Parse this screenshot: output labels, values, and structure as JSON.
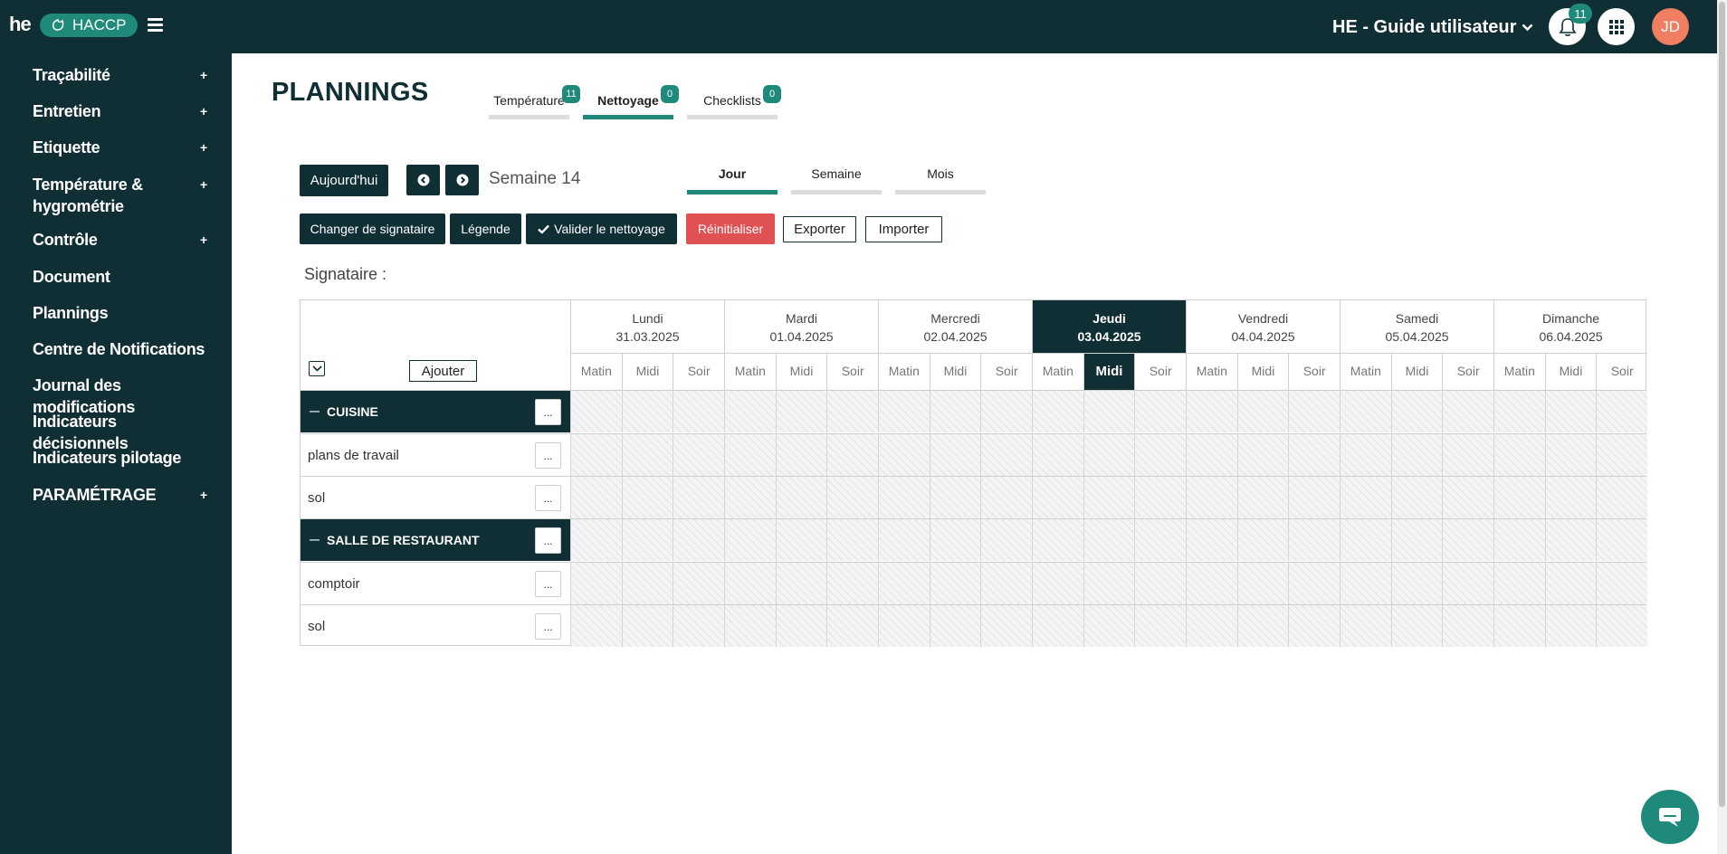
{
  "header": {
    "logo_text": "he",
    "app_name": "HACCP",
    "account_name": "HE - Guide utilisateur",
    "notification_count": "11",
    "avatar_initials": "JD"
  },
  "sidebar": {
    "items": [
      {
        "label": "Traçabilité",
        "expandable": true
      },
      {
        "label": "Entretien",
        "expandable": true
      },
      {
        "label": "Etiquette",
        "expandable": true
      },
      {
        "label": "Température & hygrométrie",
        "expandable": true
      },
      {
        "label": "Contrôle",
        "expandable": true
      },
      {
        "label": "Document",
        "expandable": false
      },
      {
        "label": "Plannings",
        "expandable": false
      },
      {
        "label": "Centre de Notifications",
        "expandable": false
      },
      {
        "label": "Journal des modifications",
        "expandable": false
      },
      {
        "label": "Indicateurs décisionnels",
        "expandable": false
      },
      {
        "label": "Indicateurs pilotage",
        "expandable": false
      },
      {
        "label": "PARAMÉTRAGE",
        "expandable": true
      }
    ],
    "plus_symbol": "+"
  },
  "main": {
    "title": "PLANNINGS",
    "tabs": [
      {
        "label": "Température",
        "badge": "11",
        "active": false
      },
      {
        "label": "Nettoyage",
        "badge": "0",
        "active": true
      },
      {
        "label": "Checklists",
        "badge": "0",
        "active": false
      }
    ],
    "toolbar": {
      "today_label": "Aujourd'hui",
      "week_label": "Semaine 14",
      "change_signer_label": "Changer de signataire",
      "legend_label": "Légende",
      "validate_label": "Valider le nettoyage",
      "reset_label": "Réinitialiser",
      "export_label": "Exporter",
      "import_label": "Importer"
    },
    "view_tabs": [
      {
        "label": "Jour",
        "active": true
      },
      {
        "label": "Semaine",
        "active": false
      },
      {
        "label": "Mois",
        "active": false
      }
    ],
    "signataire_label": "Signataire :"
  },
  "planning": {
    "add_label": "Ajouter",
    "slots": [
      "Matin",
      "Midi",
      "Soir"
    ],
    "days": [
      {
        "name": "Lundi",
        "date": "31.03.2025"
      },
      {
        "name": "Mardi",
        "date": "01.04.2025"
      },
      {
        "name": "Mercredi",
        "date": "02.04.2025"
      },
      {
        "name": "Jeudi",
        "date": "03.04.2025"
      },
      {
        "name": "Vendredi",
        "date": "04.04.2025"
      },
      {
        "name": "Samedi",
        "date": "05.04.2025"
      },
      {
        "name": "Dimanche",
        "date": "06.04.2025"
      }
    ],
    "active_day": 3,
    "active_slot": "Midi",
    "rows": [
      {
        "type": "group",
        "label": "CUISINE"
      },
      {
        "type": "task",
        "label": "plans de travail"
      },
      {
        "type": "task",
        "label": "sol"
      },
      {
        "type": "group",
        "label": "SALLE DE RESTAURANT"
      },
      {
        "type": "task",
        "label": "comptoir"
      },
      {
        "type": "task",
        "label": "sol"
      }
    ],
    "menu_dots": "..."
  },
  "colors": {
    "primary_dark": "#0f2f35",
    "accent_teal": "#1f8a7a",
    "danger": "#e05252",
    "avatar": "#f07f62"
  },
  "icons": {
    "bell": "bell-icon",
    "apps": "grid-apps-icon",
    "chat": "chat-bubble-icon",
    "prev": "chevron-left-icon",
    "next": "chevron-right-icon",
    "check": "check-icon",
    "collapse": "chevron-down-icon"
  }
}
